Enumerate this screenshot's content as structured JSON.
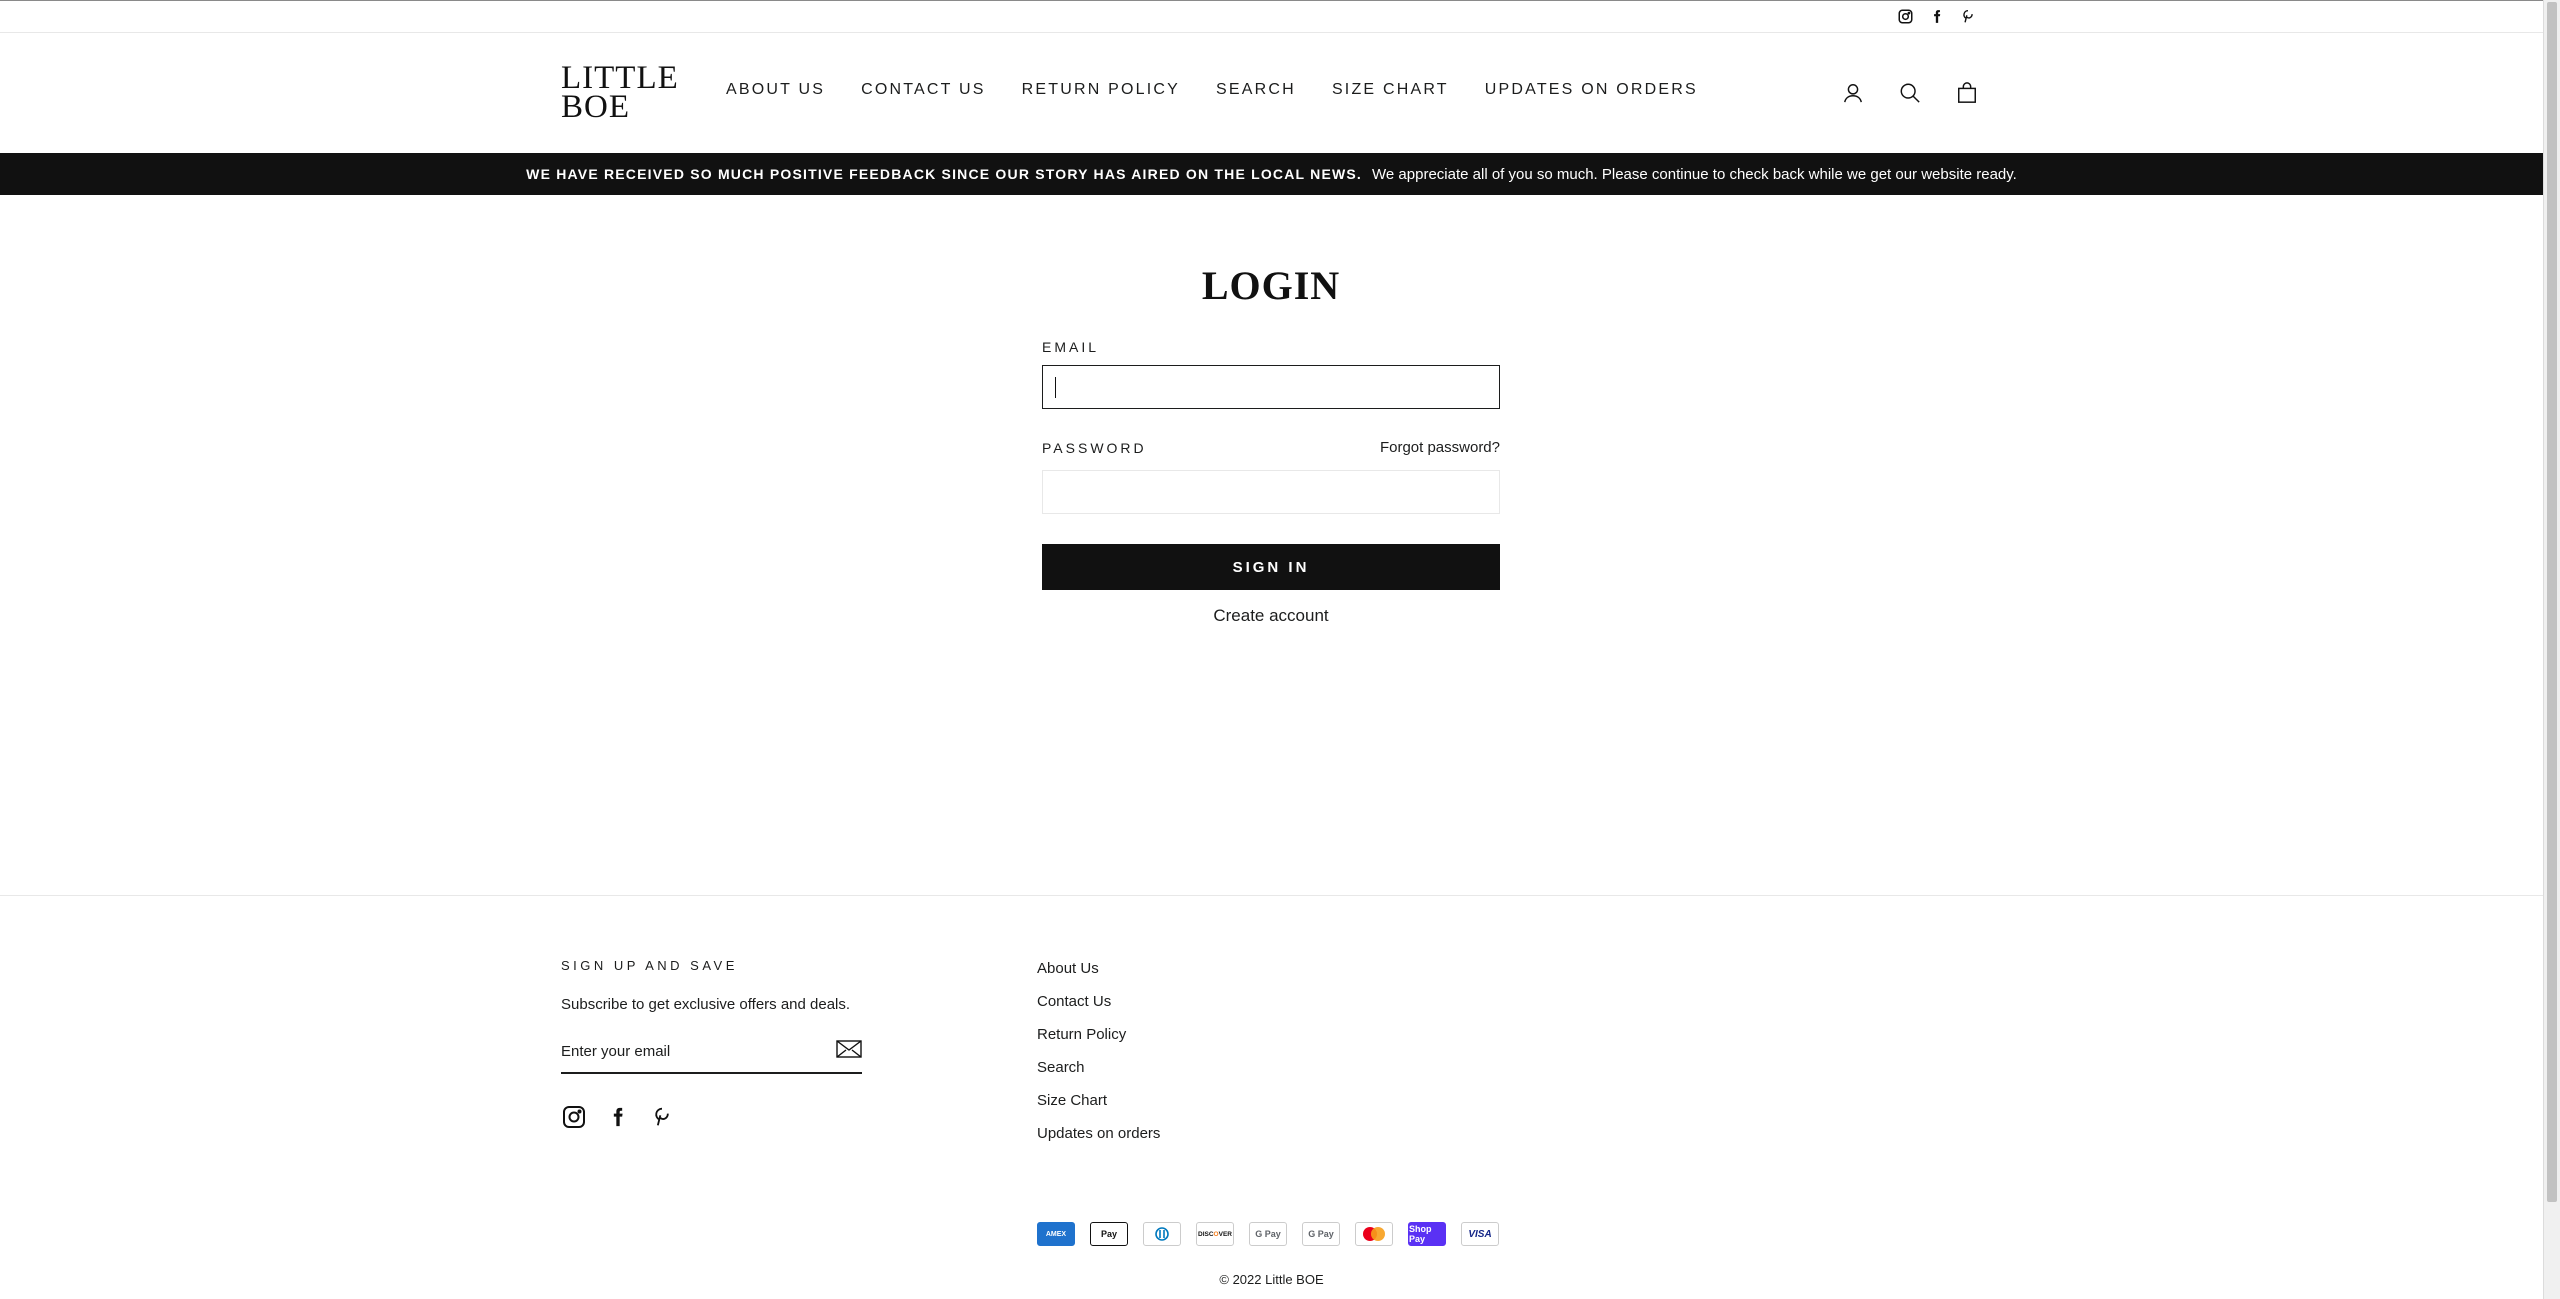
{
  "social_top": [
    "instagram-icon",
    "facebook-icon",
    "pinterest-icon"
  ],
  "logo": {
    "line1": "LITTLE",
    "line2": "BOE"
  },
  "nav": [
    {
      "label": "ABOUT US"
    },
    {
      "label": "CONTACT US"
    },
    {
      "label": "RETURN POLICY"
    },
    {
      "label": "SEARCH"
    },
    {
      "label": "SIZE CHART"
    },
    {
      "label": "UPDATES ON ORDERS"
    }
  ],
  "announcement": {
    "bold": "WE HAVE RECEIVED SO MUCH POSITIVE FEEDBACK SINCE OUR STORY HAS AIRED ON THE LOCAL NEWS.",
    "text": "We appreciate all of you so much. Please continue to check back while we get our website ready."
  },
  "login": {
    "title": "LOGIN",
    "email_label": "EMAIL",
    "email_value": "",
    "password_label": "PASSWORD",
    "forgot": "Forgot password?",
    "signin": "SIGN IN",
    "create": "Create account"
  },
  "footer": {
    "signup_title": "SIGN UP AND SAVE",
    "signup_text": "Subscribe to get exclusive offers and deals.",
    "email_placeholder": "Enter your email",
    "links": [
      "About Us",
      "Contact Us",
      "Return Policy",
      "Search",
      "Size Chart",
      "Updates on orders"
    ],
    "payments": [
      "AMEX",
      "Apple Pay",
      "Diners",
      "DISCOVER",
      "G Pay",
      "G Pay",
      "Mastercard",
      "Shop Pay",
      "VISA"
    ],
    "copyright": "© 2022 Little BOE"
  }
}
